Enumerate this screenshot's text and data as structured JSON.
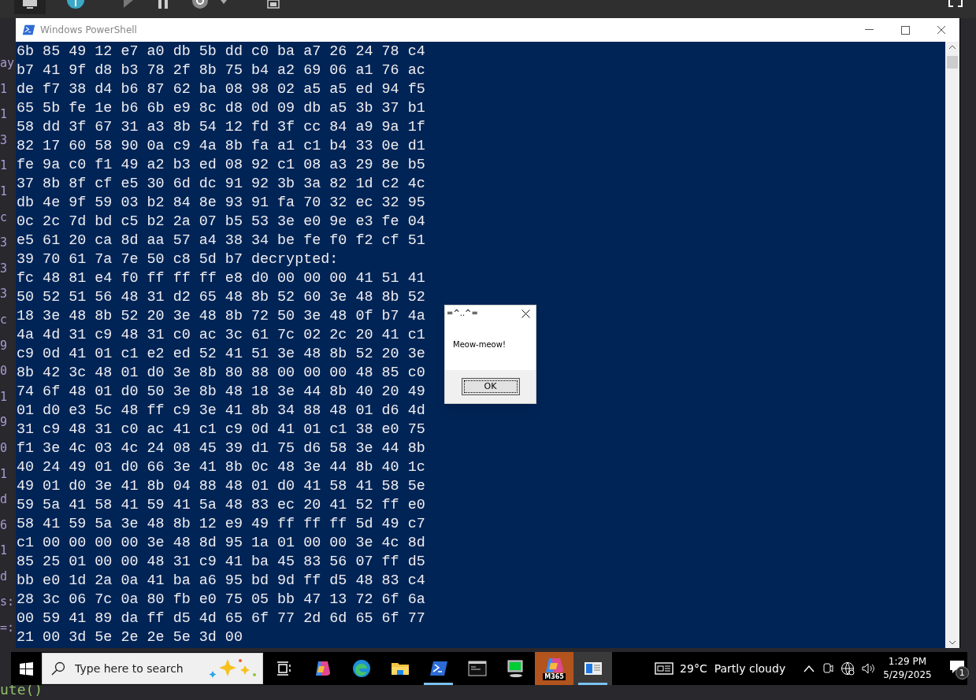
{
  "editor_fragments": [
    "ay",
    "1",
    "1",
    "3",
    "1",
    "1",
    "c",
    "3",
    "3",
    "3",
    "c",
    "9",
    "0",
    "1",
    "9",
    "0",
    "1",
    "d",
    "6",
    "1",
    "d",
    "s:",
    "=:"
  ],
  "editor_bottom": "ute()",
  "window": {
    "title": "Windows PowerShell"
  },
  "terminal": {
    "lines": [
      "6b 85 49 12 e7 a0 db 5b dd c0 ba a7 26 24 78 c4",
      "b7 41 9f d8 b3 78 2f 8b 75 b4 a2 69 06 a1 76 ac",
      "de f7 38 d4 b6 87 62 ba 08 98 02 a5 a5 ed 94 f5",
      "65 5b fe 1e b6 6b e9 8c d8 0d 09 db a5 3b 37 b1",
      "58 dd 3f 67 31 a3 8b 54 12 fd 3f cc 84 a9 9a 1f",
      "82 17 60 58 90 0a c9 4a 8b fa a1 c1 b4 33 0e d1",
      "fe 9a c0 f1 49 a2 b3 ed 08 92 c1 08 a3 29 8e b5",
      "37 8b 8f cf e5 30 6d dc 91 92 3b 3a 82 1d c2 4c",
      "db 4e 9f 59 03 b2 84 8e 93 91 fa 70 32 ec 32 95",
      "0c 2c 7d bd c5 b2 2a 07 b5 53 3e e0 9e e3 fe 04",
      "e5 61 20 ca 8d aa 57 a4 38 34 be fe f0 f2 cf 51",
      "39 70 61 7a 7e 50 c8 5d b7 decrypted:",
      "fc 48 81 e4 f0 ff ff ff e8 d0 00 00 00 41 51 41",
      "50 52 51 56 48 31 d2 65 48 8b 52 60 3e 48 8b 52",
      "18 3e 48 8b 52 20 3e 48 8b 72 50 3e 48 0f b7 4a",
      "4a 4d 31 c9 48 31 c0 ac 3c 61 7c 02 2c 20 41 c1",
      "c9 0d 41 01 c1 e2 ed 52 41 51 3e 48 8b 52 20 3e",
      "8b 42 3c 48 01 d0 3e 8b 80 88 00 00 00 48 85 c0",
      "74 6f 48 01 d0 50 3e 8b 48 18 3e 44 8b 40 20 49",
      "01 d0 e3 5c 48 ff c9 3e 41 8b 34 88 48 01 d6 4d",
      "31 c9 48 31 c0 ac 41 c1 c9 0d 41 01 c1 38 e0 75",
      "f1 3e 4c 03 4c 24 08 45 39 d1 75 d6 58 3e 44 8b",
      "40 24 49 01 d0 66 3e 41 8b 0c 48 3e 44 8b 40 1c",
      "49 01 d0 3e 41 8b 04 88 48 01 d0 41 58 41 58 5e",
      "59 5a 41 58 41 59 41 5a 48 83 ec 20 41 52 ff e0",
      "58 41 59 5a 3e 48 8b 12 e9 49 ff ff ff 5d 49 c7",
      "c1 00 00 00 00 3e 48 8d 95 1a 01 00 00 3e 4c 8d",
      "85 25 01 00 00 48 31 c9 41 ba 45 83 56 07 ff d5",
      "bb e0 1d 2a 0a 41 ba a6 95 bd 9d ff d5 48 83 c4",
      "28 3c 06 7c 0a 80 fb e0 75 05 bb 47 13 72 6f 6a",
      "00 59 41 89 da ff d5 4d 65 6f 77 2d 6d 65 6f 77",
      "21 00 3d 5e 2e 2e 5e 3d 00"
    ]
  },
  "dialog": {
    "title": "=^..^=",
    "message": "Meow-meow!",
    "button": "OK"
  },
  "taskbar": {
    "search": {
      "placeholder": "Type here to search"
    },
    "apps": [
      {
        "kind": "task-view",
        "open": false,
        "focused": false
      },
      {
        "kind": "copilot",
        "open": false,
        "focused": false
      },
      {
        "kind": "edge",
        "open": false,
        "focused": false
      },
      {
        "kind": "explorer",
        "open": false,
        "focused": false
      },
      {
        "kind": "powershell",
        "open": true,
        "focused": false
      },
      {
        "kind": "terminal",
        "open": false,
        "focused": false
      },
      {
        "kind": "remote",
        "open": false,
        "focused": false
      },
      {
        "kind": "m365",
        "label": "M365",
        "open": false,
        "focused": false
      },
      {
        "kind": "app-window",
        "open": true,
        "focused": true
      }
    ],
    "weather": {
      "temperature": "29°C",
      "condition": "Partly cloudy"
    },
    "clock": {
      "time": "1:29 PM",
      "date": "5/29/2025"
    },
    "notifications": {
      "count": "1"
    }
  }
}
